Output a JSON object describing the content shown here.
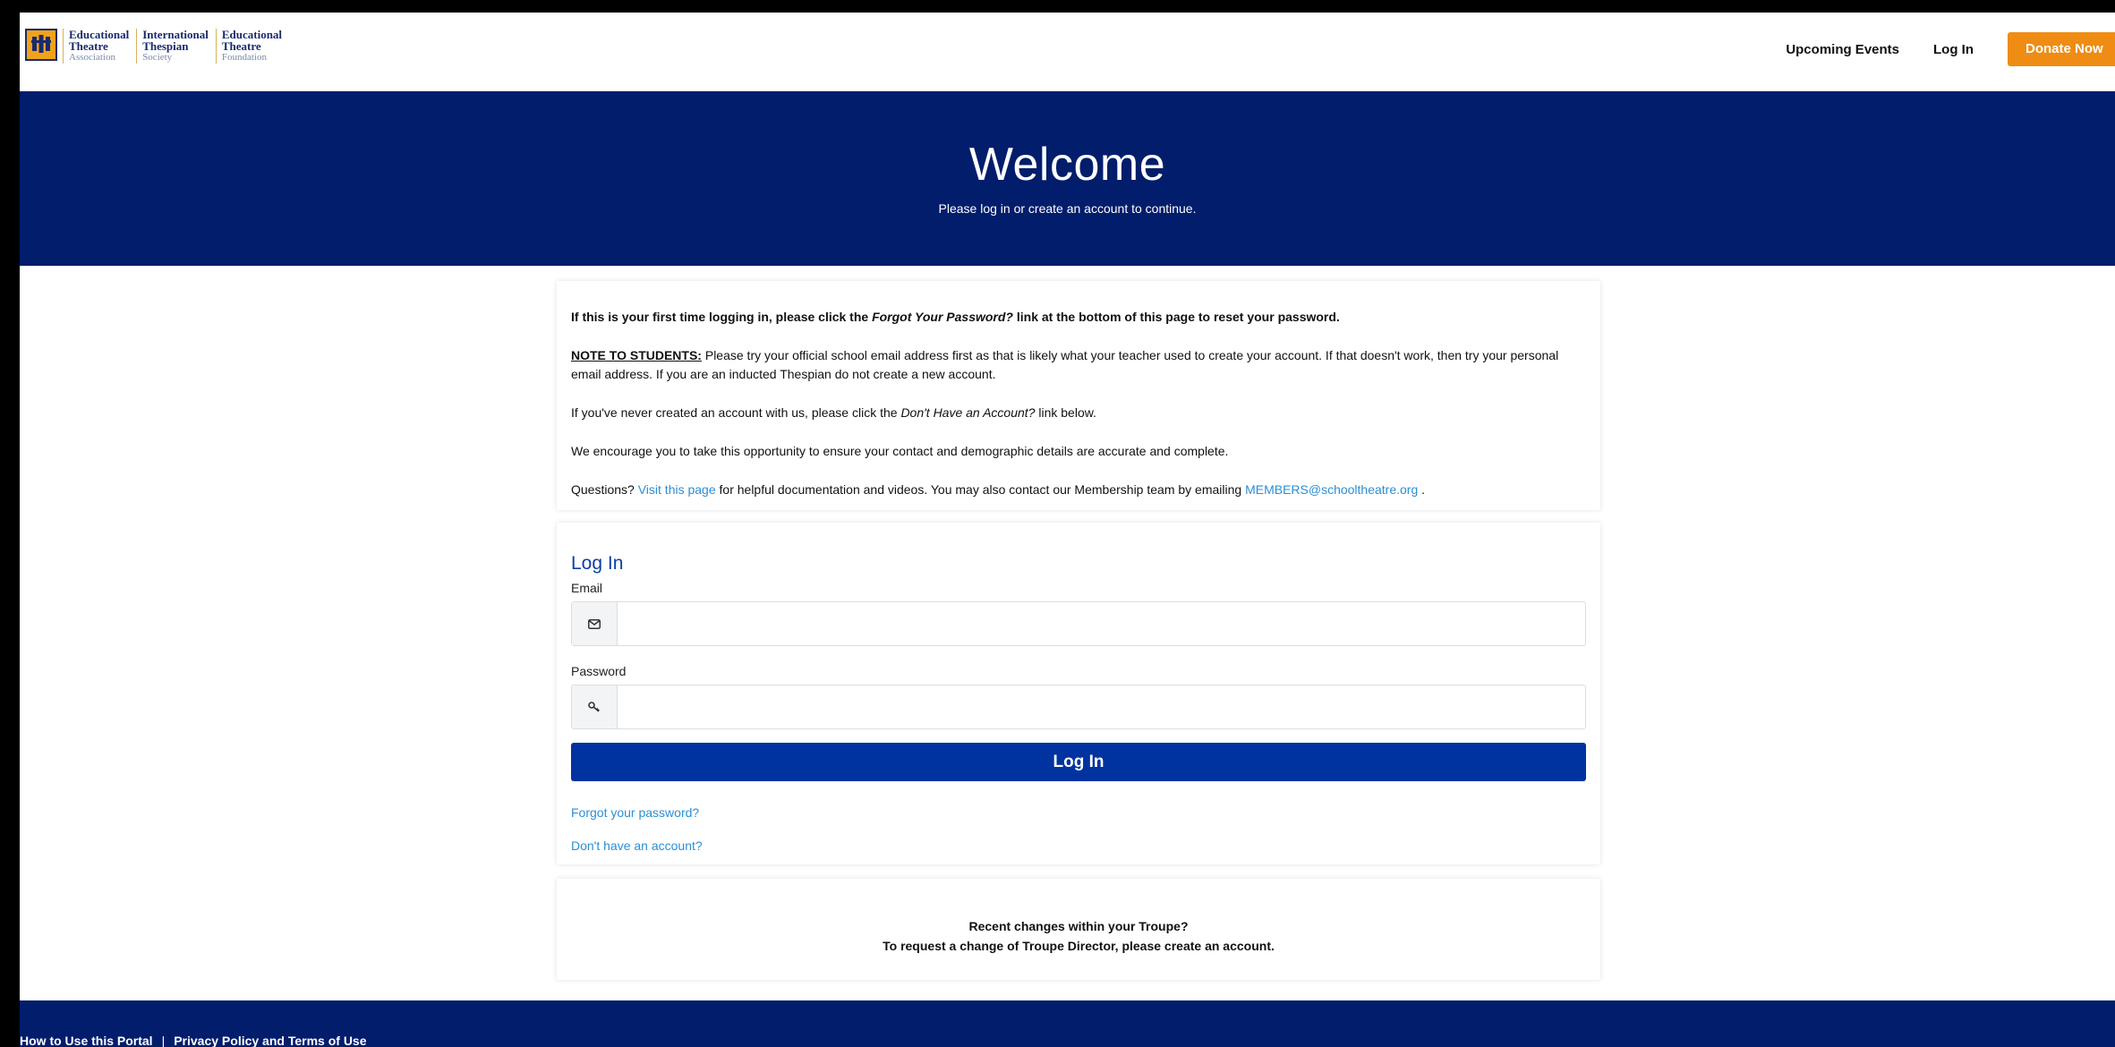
{
  "header": {
    "logo": [
      {
        "line1": "Educational",
        "line2": "Theatre",
        "line3": "Association"
      },
      {
        "line1": "International",
        "line2": "Thespian",
        "line3": "Society"
      },
      {
        "line1": "Educational",
        "line2": "Theatre",
        "line3": "Foundation"
      }
    ],
    "nav": {
      "upcoming_events": "Upcoming Events",
      "log_in": "Log In",
      "donate": "Donate Now"
    },
    "colors": {
      "navy": "#021d6b",
      "orange": "#ef8c13"
    }
  },
  "hero": {
    "title": "Welcome",
    "subtitle": "Please log in or create an account to continue."
  },
  "notice": {
    "first_login": {
      "pre": "If this is your first time logging in, please click the ",
      "em": "Forgot Your Password?",
      "post": " link at the bottom of this page to reset your password."
    },
    "students": {
      "label": "NOTE TO STUDENTS:",
      "text": " Please try your official school email address first as that is likely what your teacher used to create your account. If that doesn't work, then try your personal email address. If you are an inducted Thespian do not create a new account."
    },
    "never_created": {
      "pre": "If you've never created an account with us, please click the ",
      "em": "Don't Have an Account?",
      "post": " link below."
    },
    "encourage": "We encourage you to take this opportunity to ensure your contact and demographic details are accurate and complete.",
    "questions": {
      "pre": "Questions? ",
      "link": "Visit this page",
      "mid": " for helpful documentation and videos. You may also contact our Membership team by emailing ",
      "email": "MEMBERS@schooltheatre.org",
      "post": " ."
    }
  },
  "login": {
    "title": "Log In",
    "email_label": "Email",
    "email_icon": "envelope-icon",
    "email_value": "",
    "password_label": "Password",
    "password_icon": "key-icon",
    "password_value": "",
    "button": "Log In",
    "forgot": "Forgot your password?",
    "no_account": "Don't have an account?"
  },
  "troupe": {
    "line1": "Recent changes within your Troupe?",
    "line2": "To request a change of Troupe Director, please create an account."
  },
  "footer": {
    "how_to": "How to Use this Portal",
    "separator": "|",
    "privacy": "Privacy Policy and Terms of Use"
  }
}
